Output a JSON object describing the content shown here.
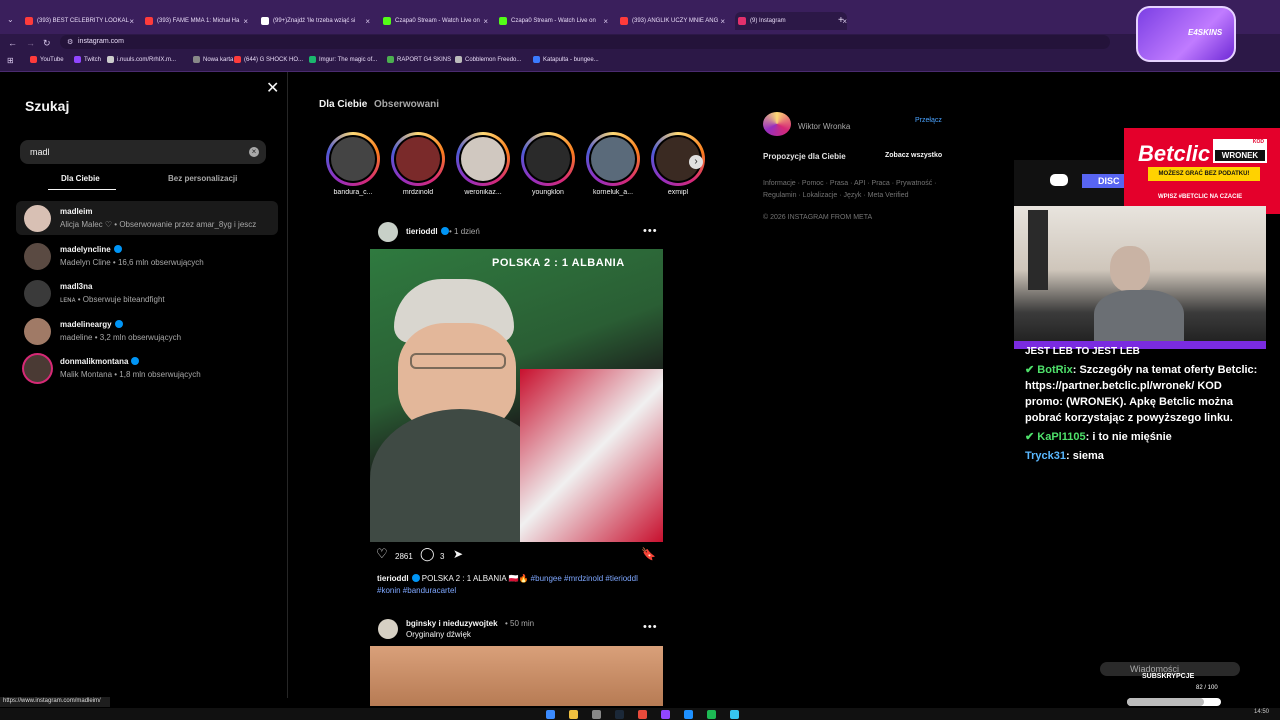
{
  "browser": {
    "tabs": [
      {
        "label": "(393) BEST CELEBRITY LOOKAL",
        "color": "#ff3b3b"
      },
      {
        "label": "(393) FAME MMA 1: Michał Ha",
        "color": "#ff3b3b"
      },
      {
        "label": "(99+)Znajdź 'Ile trzeba wziąć si",
        "color": "#ffffff"
      },
      {
        "label": "Czapa0 Stream - Watch Live on",
        "color": "#53fc18"
      },
      {
        "label": "Czapa0 Stream - Watch Live on",
        "color": "#53fc18"
      },
      {
        "label": "(393) ANGLIK UCZY MNIE ANG",
        "color": "#ff3b3b"
      },
      {
        "label": "(9) Instagram",
        "color": "#e1306c"
      }
    ],
    "url": "instagram.com",
    "bookmarks": [
      {
        "label": "YouTube",
        "color": "#ff3b3b"
      },
      {
        "label": "Twitch",
        "color": "#9146ff"
      },
      {
        "label": "i.nuuls.com/RrhIX.m...",
        "color": "#cccccc"
      },
      {
        "label": "Nowa karta",
        "color": "#888888"
      },
      {
        "label": "(644) G SHOCK HO...",
        "color": "#ff3b3b"
      },
      {
        "label": "Imgur: The magic of...",
        "color": "#1bb76e"
      },
      {
        "label": "RAPORT G4 SKINS",
        "color": "#4caf50"
      },
      {
        "label": "Cobblemon Freedo...",
        "color": "#bbbbbb"
      },
      {
        "label": "Katapulta - bungee...",
        "color": "#3b7bff"
      }
    ],
    "status_url": "https://www.instagram.com/madleim/"
  },
  "search": {
    "title": "Szukaj",
    "query": "madl",
    "tabs": [
      "Dla Ciebie",
      "Bez personalizacji"
    ],
    "results": [
      {
        "username": "madleim",
        "sub": "Alicja Malec ♡ • Obserwowanie przez amar_8yg i jescz",
        "verified": false,
        "color": "#d8c0b4"
      },
      {
        "username": "madelyncline",
        "sub": "Madelyn Cline • 16,6 mln obserwujących",
        "verified": true,
        "color": "#5a4a42"
      },
      {
        "username": "madl3na",
        "sub": "ʟᴇɴᴀ • Obserwuje biteandfight",
        "verified": false,
        "color": "#3a3a3a"
      },
      {
        "username": "madelineargy",
        "sub": "madeline • 3,2 mln obserwujących",
        "verified": true,
        "color": "#a07a66"
      },
      {
        "username": "donmalikmontana",
        "sub": "Malik Montana • 1,8 mln obserwujących",
        "verified": true,
        "color": "#4a3a34"
      }
    ]
  },
  "feed": {
    "tabs": [
      "Dla Ciebie",
      "Obserwowani"
    ],
    "stories": [
      {
        "label": "bandura_c...",
        "color": "#444444"
      },
      {
        "label": "mrdzinold",
        "color": "#7a2a2a"
      },
      {
        "label": "weronikaz...",
        "color": "#d0c8c0"
      },
      {
        "label": "youngklon",
        "color": "#2a2a2a"
      },
      {
        "label": "korneluk_a...",
        "color": "#5a6a7a"
      },
      {
        "label": "exmipl",
        "color": "#3a2a22"
      }
    ],
    "post1": {
      "username": "tierioddl",
      "time": "1 dzień",
      "banner": "POLSKA 2 : 1 ALBANIA",
      "likes": "2861",
      "comments": "3",
      "caption_user": "tierioddl",
      "caption_text": "POLSKA 2 : 1 ALBANIA 🇵🇱🔥",
      "hashtags_line1": "#bungee #mrdzinold #tierioddl",
      "hashtags_line2": "#konin #banduracartel"
    },
    "post2": {
      "username": "bginsky i nieduzywojtek",
      "time": "50 min",
      "audio": "Oryginalny dźwięk"
    }
  },
  "sidebar_right": {
    "fullname": "Wiktor Wronka",
    "switch": "Przełącz",
    "suggest_title": "Propozycje dla Ciebie",
    "see_all": "Zobacz wszystko",
    "footer": "Informacje · Pomoc · Prasa · API · Praca · Prywatność · Regulamin · Lokalizacje · Język · Meta Verified",
    "copyright": "© 2026 INSTAGRAM FROM META"
  },
  "overlay": {
    "esk_text": "E4SKINS",
    "betclic_logo": "Betclic",
    "kod_label": "KOD",
    "kod_value": "WRONEK",
    "betclic_strip": "MOŻESZ GRAĆ BEZ PODATKU!",
    "betclic_wpisz": "WPISZ #BETCLIC NA CZACIE",
    "discord_label": "DISC",
    "chat_title": "JEST LEB TO JEST LEB",
    "chat": [
      {
        "nick": "BotRix",
        "text": ": Szczegóły na temat oferty Betclic: https://partner.betclic.pl/wronek/ KOD promo: (WRONEK). Apkę Betclic można pobrać korzystając z powyższego linku.",
        "nick_color": "green"
      },
      {
        "nick": "KaPl1105",
        "text": ": i to nie mięśnie",
        "nick_color": "green"
      },
      {
        "nick": "Tryck31",
        "text": ": siema",
        "nick_color": "blue"
      }
    ],
    "sub_notification": "Wiadomości",
    "sub_label": "SUBSKRYPCJE",
    "sub_progress": "82 / 100",
    "sub_fraction": 0.82
  },
  "clock": "14:50"
}
